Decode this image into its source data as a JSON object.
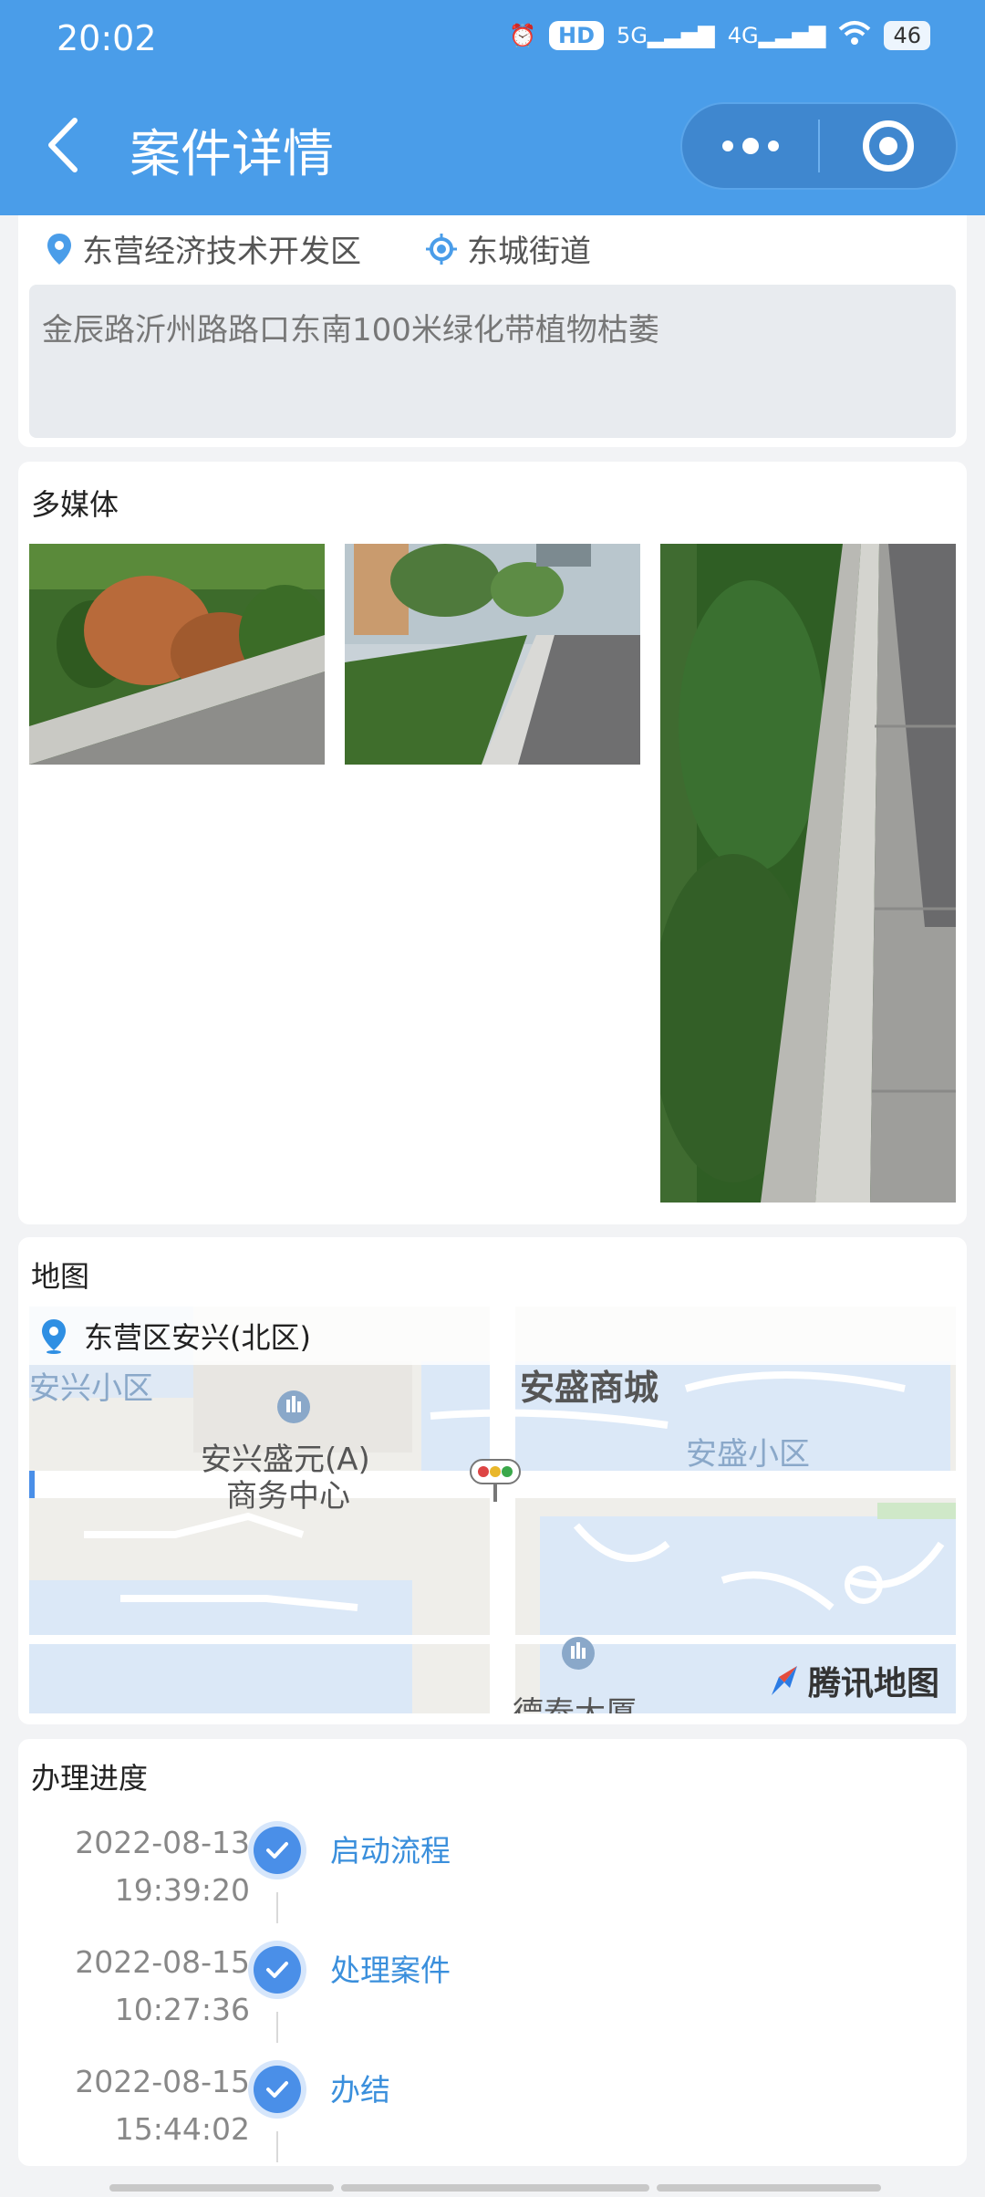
{
  "status_bar": {
    "time": "20:02",
    "signal_1": "5G",
    "signal_2": "4G",
    "hd": "HD",
    "battery": "46"
  },
  "header": {
    "title": "案件详情"
  },
  "location": {
    "district": "东营经济技术开发区",
    "street": "东城街道",
    "description": "金辰路沂州路路口东南100米绿化带植物枯萎"
  },
  "media": {
    "title": "多媒体"
  },
  "map": {
    "title": "地图",
    "address": "东营区安兴(北区)",
    "labels": {
      "anxing_community": "安兴小区",
      "ansheng_mall": "安盛商城",
      "ansheng_community": "安盛小区",
      "business_center_1": "安兴盛元(A)",
      "business_center_2": "商务中心",
      "building": "德泰大厦"
    },
    "provider": "腾讯地图"
  },
  "progress": {
    "title": "办理进度",
    "steps": [
      {
        "date": "2022-08-13",
        "time": "19:39:20",
        "label": "启动流程"
      },
      {
        "date": "2022-08-15",
        "time": "10:27:36",
        "label": "处理案件"
      },
      {
        "date": "2022-08-15",
        "time": "15:44:02",
        "label": "办结"
      }
    ]
  },
  "colors": {
    "primary": "#4a9de9",
    "link": "#3a8fdc",
    "check": "#4a8fe8"
  }
}
